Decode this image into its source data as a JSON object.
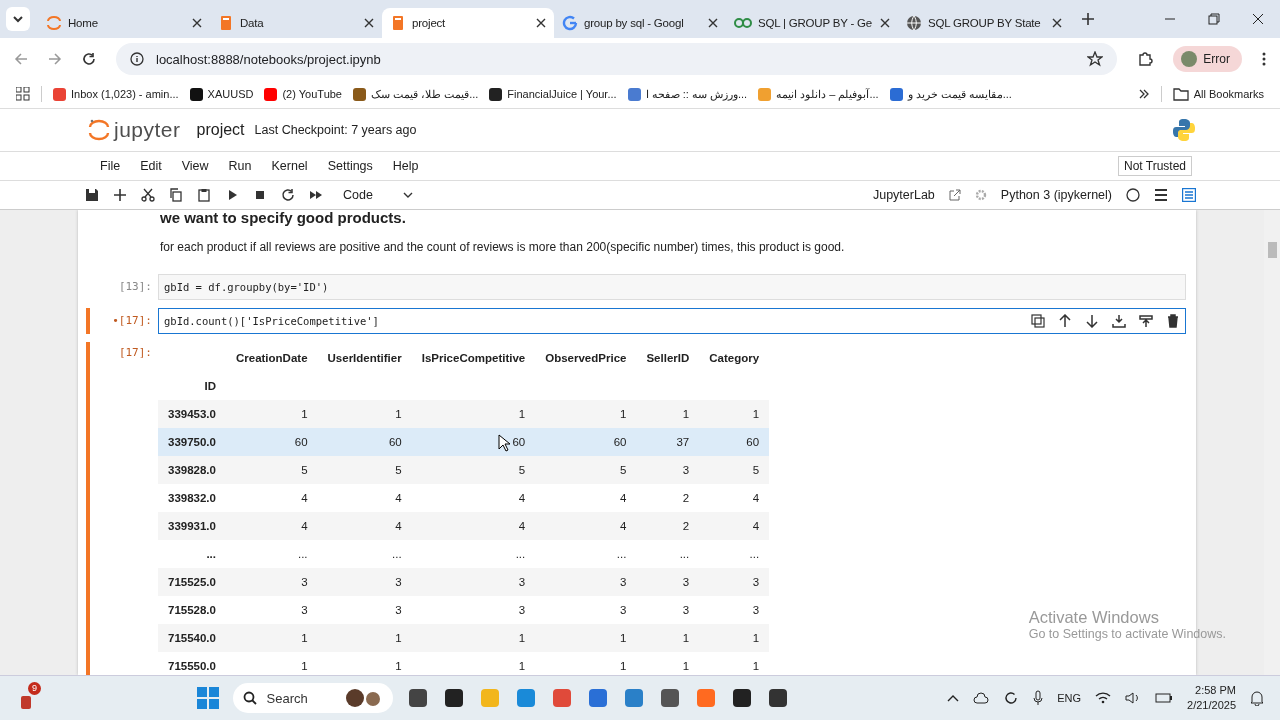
{
  "browser": {
    "tabs": [
      {
        "title": "Home",
        "kind": "jupyter",
        "selected": false
      },
      {
        "title": "Data",
        "kind": "notebook",
        "selected": false
      },
      {
        "title": "project",
        "kind": "notebook",
        "selected": true
      },
      {
        "title": "group by sql - Googl",
        "kind": "google",
        "selected": false
      },
      {
        "title": "SQL | GROUP BY - Ge",
        "kind": "gfg",
        "selected": false
      },
      {
        "title": "SQL GROUP BY State",
        "kind": "globe",
        "selected": false
      }
    ],
    "url": "localhost:8888/notebooks/project.ipynb",
    "profile": "Error",
    "bookmarks": [
      {
        "label": "Inbox (1,023) - amin...",
        "color": "#ea4335"
      },
      {
        "label": "XAUUSD",
        "color": "#111111"
      },
      {
        "label": "(2) YouTube",
        "color": "#ff0000"
      },
      {
        "label": "قیمت طلا، قیمت سک...",
        "color": "#8a5a1a"
      },
      {
        "label": "FinancialJuice | Your...",
        "color": "#222222"
      },
      {
        "label": "ورزش سه :: صفحه ا...",
        "color": "#4a7bd0"
      },
      {
        "label": "آبوفیلم – دانلود انیمه...",
        "color": "#f0a030"
      },
      {
        "label": "مقایسه قیمت خرید و...",
        "color": "#2b6cd4"
      }
    ],
    "all_bookmarks": "All Bookmarks"
  },
  "jupyter": {
    "logo": "jupyter",
    "notebook": "project",
    "checkpoint": "Last Checkpoint: 7 years ago",
    "menu": [
      "File",
      "Edit",
      "View",
      "Run",
      "Kernel",
      "Settings",
      "Help"
    ],
    "trust": "Not Trusted",
    "cell_type": "Code",
    "lab_link": "JupyterLab",
    "kernel": "Python 3 (ipykernel)"
  },
  "notebook": {
    "heading": "we want to specify good products.",
    "paragraph": "for each product if all reviews are positive and the count of reviews is more than 200(specific number) times, this product is good.",
    "cells": [
      {
        "prompt": "[13]:",
        "code": "gbId = df.groupby(by='ID')",
        "selected": false
      },
      {
        "prompt": "•[17]:",
        "code": "gbId.count()['IsPriceCompetitive']",
        "selected": true
      }
    ],
    "output": {
      "prompt": "[17]:",
      "index_name": "ID",
      "columns": [
        "CreationDate",
        "UserIdentifier",
        "IsPriceCompetitive",
        "ObservedPrice",
        "SellerID",
        "Category"
      ],
      "rows": [
        {
          "index": "339453.0",
          "values": [
            "1",
            "1",
            "1",
            "1",
            "1",
            "1"
          ],
          "highlighted": false
        },
        {
          "index": "339750.0",
          "values": [
            "60",
            "60",
            "60",
            "60",
            "37",
            "60"
          ],
          "highlighted": true
        },
        {
          "index": "339828.0",
          "values": [
            "5",
            "5",
            "5",
            "5",
            "3",
            "5"
          ],
          "highlighted": false
        },
        {
          "index": "339832.0",
          "values": [
            "4",
            "4",
            "4",
            "4",
            "2",
            "4"
          ],
          "highlighted": false
        },
        {
          "index": "339931.0",
          "values": [
            "4",
            "4",
            "4",
            "4",
            "2",
            "4"
          ],
          "highlighted": false
        },
        {
          "index": "...",
          "values": [
            "...",
            "...",
            "...",
            "...",
            "...",
            "..."
          ],
          "highlighted": false
        },
        {
          "index": "715525.0",
          "values": [
            "3",
            "3",
            "3",
            "3",
            "3",
            "3"
          ],
          "highlighted": false
        },
        {
          "index": "715528.0",
          "values": [
            "3",
            "3",
            "3",
            "3",
            "3",
            "3"
          ],
          "highlighted": false
        },
        {
          "index": "715540.0",
          "values": [
            "1",
            "1",
            "1",
            "1",
            "1",
            "1"
          ],
          "highlighted": false
        },
        {
          "index": "715550.0",
          "values": [
            "1",
            "1",
            "1",
            "1",
            "1",
            "1"
          ],
          "highlighted": false
        }
      ]
    }
  },
  "activation": {
    "title": "Activate Windows",
    "hint": "Go to Settings to activate Windows."
  },
  "taskbar": {
    "badge": "9",
    "search": "Search",
    "language": "ENG",
    "time": "2:58 PM",
    "date": "2/21/2025"
  }
}
